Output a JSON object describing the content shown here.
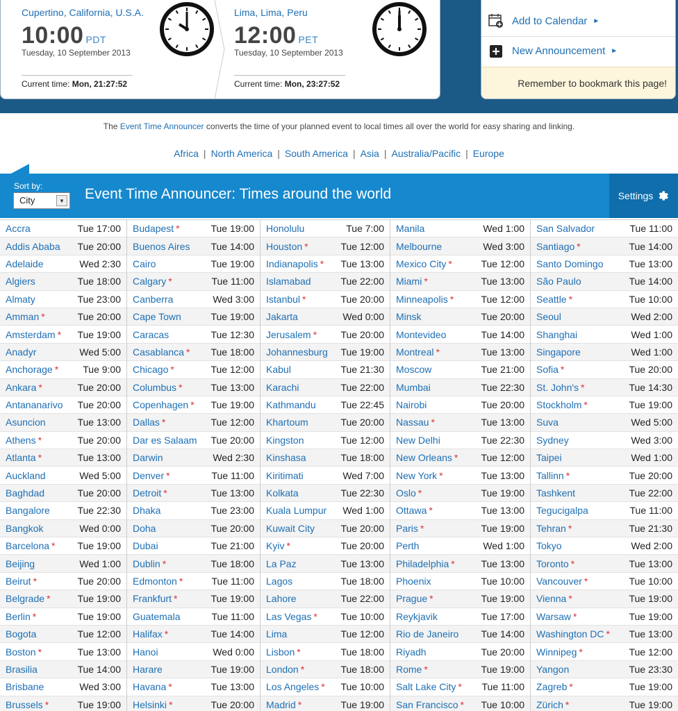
{
  "locations": [
    {
      "name": "Cupertino, California, U.S.A.",
      "time": "10:00",
      "tz": "PDT",
      "date": "Tuesday, 10 September 2013",
      "current_label": "Current time:",
      "current_value": "Mon, 21:27:52"
    },
    {
      "name": "Lima, Lima, Peru",
      "time": "12:00",
      "tz": "PET",
      "date": "Tuesday, 10 September 2013",
      "current_label": "Current time:",
      "current_value": "Mon, 23:27:52"
    }
  ],
  "side": {
    "add_calendar": "Add to Calendar",
    "new_announcement": "New Announcement",
    "bookmark": "Remember to bookmark this page!"
  },
  "intro": {
    "pre": "The ",
    "link": "Event Time Announcer",
    "post": " converts the time of your planned event to local times all over the world for easy sharing and linking."
  },
  "regions": [
    "Africa",
    "North America",
    "South America",
    "Asia",
    "Australia/Pacific",
    "Europe"
  ],
  "banner": {
    "sort_label": "Sort by:",
    "sort_value": "City",
    "title": "Event Time Announcer: Times around the world",
    "settings": "Settings"
  },
  "columns": [
    [
      {
        "city": "Accra",
        "dst": false,
        "time": "Tue 17:00"
      },
      {
        "city": "Addis Ababa",
        "dst": false,
        "time": "Tue 20:00"
      },
      {
        "city": "Adelaide",
        "dst": false,
        "time": "Wed 2:30"
      },
      {
        "city": "Algiers",
        "dst": false,
        "time": "Tue 18:00"
      },
      {
        "city": "Almaty",
        "dst": false,
        "time": "Tue 23:00"
      },
      {
        "city": "Amman",
        "dst": true,
        "time": "Tue 20:00"
      },
      {
        "city": "Amsterdam",
        "dst": true,
        "time": "Tue 19:00"
      },
      {
        "city": "Anadyr",
        "dst": false,
        "time": "Wed 5:00"
      },
      {
        "city": "Anchorage",
        "dst": true,
        "time": "Tue 9:00"
      },
      {
        "city": "Ankara",
        "dst": true,
        "time": "Tue 20:00"
      },
      {
        "city": "Antananarivo",
        "dst": false,
        "time": "Tue 20:00"
      },
      {
        "city": "Asuncion",
        "dst": false,
        "time": "Tue 13:00"
      },
      {
        "city": "Athens",
        "dst": true,
        "time": "Tue 20:00"
      },
      {
        "city": "Atlanta",
        "dst": true,
        "time": "Tue 13:00"
      },
      {
        "city": "Auckland",
        "dst": false,
        "time": "Wed 5:00"
      },
      {
        "city": "Baghdad",
        "dst": false,
        "time": "Tue 20:00"
      },
      {
        "city": "Bangalore",
        "dst": false,
        "time": "Tue 22:30"
      },
      {
        "city": "Bangkok",
        "dst": false,
        "time": "Wed 0:00"
      },
      {
        "city": "Barcelona",
        "dst": true,
        "time": "Tue 19:00"
      },
      {
        "city": "Beijing",
        "dst": false,
        "time": "Wed 1:00"
      },
      {
        "city": "Beirut",
        "dst": true,
        "time": "Tue 20:00"
      },
      {
        "city": "Belgrade",
        "dst": true,
        "time": "Tue 19:00"
      },
      {
        "city": "Berlin",
        "dst": true,
        "time": "Tue 19:00"
      },
      {
        "city": "Bogota",
        "dst": false,
        "time": "Tue 12:00"
      },
      {
        "city": "Boston",
        "dst": true,
        "time": "Tue 13:00"
      },
      {
        "city": "Brasilia",
        "dst": false,
        "time": "Tue 14:00"
      },
      {
        "city": "Brisbane",
        "dst": false,
        "time": "Wed 3:00"
      },
      {
        "city": "Brussels",
        "dst": true,
        "time": "Tue 19:00"
      }
    ],
    [
      {
        "city": "Budapest",
        "dst": true,
        "time": "Tue 19:00"
      },
      {
        "city": "Buenos Aires",
        "dst": false,
        "time": "Tue 14:00"
      },
      {
        "city": "Cairo",
        "dst": false,
        "time": "Tue 19:00"
      },
      {
        "city": "Calgary",
        "dst": true,
        "time": "Tue 11:00"
      },
      {
        "city": "Canberra",
        "dst": false,
        "time": "Wed 3:00"
      },
      {
        "city": "Cape Town",
        "dst": false,
        "time": "Tue 19:00"
      },
      {
        "city": "Caracas",
        "dst": false,
        "time": "Tue 12:30"
      },
      {
        "city": "Casablanca",
        "dst": true,
        "time": "Tue 18:00"
      },
      {
        "city": "Chicago",
        "dst": true,
        "time": "Tue 12:00"
      },
      {
        "city": "Columbus",
        "dst": true,
        "time": "Tue 13:00"
      },
      {
        "city": "Copenhagen",
        "dst": true,
        "time": "Tue 19:00"
      },
      {
        "city": "Dallas",
        "dst": true,
        "time": "Tue 12:00"
      },
      {
        "city": "Dar es Salaam",
        "dst": false,
        "time": "Tue 20:00"
      },
      {
        "city": "Darwin",
        "dst": false,
        "time": "Wed 2:30"
      },
      {
        "city": "Denver",
        "dst": true,
        "time": "Tue 11:00"
      },
      {
        "city": "Detroit",
        "dst": true,
        "time": "Tue 13:00"
      },
      {
        "city": "Dhaka",
        "dst": false,
        "time": "Tue 23:00"
      },
      {
        "city": "Doha",
        "dst": false,
        "time": "Tue 20:00"
      },
      {
        "city": "Dubai",
        "dst": false,
        "time": "Tue 21:00"
      },
      {
        "city": "Dublin",
        "dst": true,
        "time": "Tue 18:00"
      },
      {
        "city": "Edmonton",
        "dst": true,
        "time": "Tue 11:00"
      },
      {
        "city": "Frankfurt",
        "dst": true,
        "time": "Tue 19:00"
      },
      {
        "city": "Guatemala",
        "dst": false,
        "time": "Tue 11:00"
      },
      {
        "city": "Halifax",
        "dst": true,
        "time": "Tue 14:00"
      },
      {
        "city": "Hanoi",
        "dst": false,
        "time": "Wed 0:00"
      },
      {
        "city": "Harare",
        "dst": false,
        "time": "Tue 19:00"
      },
      {
        "city": "Havana",
        "dst": true,
        "time": "Tue 13:00"
      },
      {
        "city": "Helsinki",
        "dst": true,
        "time": "Tue 20:00"
      }
    ],
    [
      {
        "city": "Honolulu",
        "dst": false,
        "time": "Tue 7:00"
      },
      {
        "city": "Houston",
        "dst": true,
        "time": "Tue 12:00"
      },
      {
        "city": "Indianapolis",
        "dst": true,
        "time": "Tue 13:00"
      },
      {
        "city": "Islamabad",
        "dst": false,
        "time": "Tue 22:00"
      },
      {
        "city": "Istanbul",
        "dst": true,
        "time": "Tue 20:00"
      },
      {
        "city": "Jakarta",
        "dst": false,
        "time": "Wed 0:00"
      },
      {
        "city": "Jerusalem",
        "dst": true,
        "time": "Tue 20:00"
      },
      {
        "city": "Johannesburg",
        "dst": false,
        "time": "Tue 19:00"
      },
      {
        "city": "Kabul",
        "dst": false,
        "time": "Tue 21:30"
      },
      {
        "city": "Karachi",
        "dst": false,
        "time": "Tue 22:00"
      },
      {
        "city": "Kathmandu",
        "dst": false,
        "time": "Tue 22:45"
      },
      {
        "city": "Khartoum",
        "dst": false,
        "time": "Tue 20:00"
      },
      {
        "city": "Kingston",
        "dst": false,
        "time": "Tue 12:00"
      },
      {
        "city": "Kinshasa",
        "dst": false,
        "time": "Tue 18:00"
      },
      {
        "city": "Kiritimati",
        "dst": false,
        "time": "Wed 7:00"
      },
      {
        "city": "Kolkata",
        "dst": false,
        "time": "Tue 22:30"
      },
      {
        "city": "Kuala Lumpur",
        "dst": false,
        "time": "Wed 1:00"
      },
      {
        "city": "Kuwait City",
        "dst": false,
        "time": "Tue 20:00"
      },
      {
        "city": "Kyiv",
        "dst": true,
        "time": "Tue 20:00"
      },
      {
        "city": "La Paz",
        "dst": false,
        "time": "Tue 13:00"
      },
      {
        "city": "Lagos",
        "dst": false,
        "time": "Tue 18:00"
      },
      {
        "city": "Lahore",
        "dst": false,
        "time": "Tue 22:00"
      },
      {
        "city": "Las Vegas",
        "dst": true,
        "time": "Tue 10:00"
      },
      {
        "city": "Lima",
        "dst": false,
        "time": "Tue 12:00"
      },
      {
        "city": "Lisbon",
        "dst": true,
        "time": "Tue 18:00"
      },
      {
        "city": "London",
        "dst": true,
        "time": "Tue 18:00"
      },
      {
        "city": "Los Angeles",
        "dst": true,
        "time": "Tue 10:00"
      },
      {
        "city": "Madrid",
        "dst": true,
        "time": "Tue 19:00"
      }
    ],
    [
      {
        "city": "Manila",
        "dst": false,
        "time": "Wed 1:00"
      },
      {
        "city": "Melbourne",
        "dst": false,
        "time": "Wed 3:00"
      },
      {
        "city": "Mexico City",
        "dst": true,
        "time": "Tue 12:00"
      },
      {
        "city": "Miami",
        "dst": true,
        "time": "Tue 13:00"
      },
      {
        "city": "Minneapolis",
        "dst": true,
        "time": "Tue 12:00"
      },
      {
        "city": "Minsk",
        "dst": false,
        "time": "Tue 20:00"
      },
      {
        "city": "Montevideo",
        "dst": false,
        "time": "Tue 14:00"
      },
      {
        "city": "Montreal",
        "dst": true,
        "time": "Tue 13:00"
      },
      {
        "city": "Moscow",
        "dst": false,
        "time": "Tue 21:00"
      },
      {
        "city": "Mumbai",
        "dst": false,
        "time": "Tue 22:30"
      },
      {
        "city": "Nairobi",
        "dst": false,
        "time": "Tue 20:00"
      },
      {
        "city": "Nassau",
        "dst": true,
        "time": "Tue 13:00"
      },
      {
        "city": "New Delhi",
        "dst": false,
        "time": "Tue 22:30"
      },
      {
        "city": "New Orleans",
        "dst": true,
        "time": "Tue 12:00"
      },
      {
        "city": "New York",
        "dst": true,
        "time": "Tue 13:00"
      },
      {
        "city": "Oslo",
        "dst": true,
        "time": "Tue 19:00"
      },
      {
        "city": "Ottawa",
        "dst": true,
        "time": "Tue 13:00"
      },
      {
        "city": "Paris",
        "dst": true,
        "time": "Tue 19:00"
      },
      {
        "city": "Perth",
        "dst": false,
        "time": "Wed 1:00"
      },
      {
        "city": "Philadelphia",
        "dst": true,
        "time": "Tue 13:00"
      },
      {
        "city": "Phoenix",
        "dst": false,
        "time": "Tue 10:00"
      },
      {
        "city": "Prague",
        "dst": true,
        "time": "Tue 19:00"
      },
      {
        "city": "Reykjavik",
        "dst": false,
        "time": "Tue 17:00"
      },
      {
        "city": "Rio de Janeiro",
        "dst": false,
        "time": "Tue 14:00"
      },
      {
        "city": "Riyadh",
        "dst": false,
        "time": "Tue 20:00"
      },
      {
        "city": "Rome",
        "dst": true,
        "time": "Tue 19:00"
      },
      {
        "city": "Salt Lake City",
        "dst": true,
        "time": "Tue 11:00"
      },
      {
        "city": "San Francisco",
        "dst": true,
        "time": "Tue 10:00"
      }
    ],
    [
      {
        "city": "San Salvador",
        "dst": false,
        "time": "Tue 11:00"
      },
      {
        "city": "Santiago",
        "dst": true,
        "time": "Tue 14:00"
      },
      {
        "city": "Santo Domingo",
        "dst": false,
        "time": "Tue 13:00"
      },
      {
        "city": "São Paulo",
        "dst": false,
        "time": "Tue 14:00"
      },
      {
        "city": "Seattle",
        "dst": true,
        "time": "Tue 10:00"
      },
      {
        "city": "Seoul",
        "dst": false,
        "time": "Wed 2:00"
      },
      {
        "city": "Shanghai",
        "dst": false,
        "time": "Wed 1:00"
      },
      {
        "city": "Singapore",
        "dst": false,
        "time": "Wed 1:00"
      },
      {
        "city": "Sofia",
        "dst": true,
        "time": "Tue 20:00"
      },
      {
        "city": "St. John's",
        "dst": true,
        "time": "Tue 14:30"
      },
      {
        "city": "Stockholm",
        "dst": true,
        "time": "Tue 19:00"
      },
      {
        "city": "Suva",
        "dst": false,
        "time": "Wed 5:00"
      },
      {
        "city": "Sydney",
        "dst": false,
        "time": "Wed 3:00"
      },
      {
        "city": "Taipei",
        "dst": false,
        "time": "Wed 1:00"
      },
      {
        "city": "Tallinn",
        "dst": true,
        "time": "Tue 20:00"
      },
      {
        "city": "Tashkent",
        "dst": false,
        "time": "Tue 22:00"
      },
      {
        "city": "Tegucigalpa",
        "dst": false,
        "time": "Tue 11:00"
      },
      {
        "city": "Tehran",
        "dst": true,
        "time": "Tue 21:30"
      },
      {
        "city": "Tokyo",
        "dst": false,
        "time": "Wed 2:00"
      },
      {
        "city": "Toronto",
        "dst": true,
        "time": "Tue 13:00"
      },
      {
        "city": "Vancouver",
        "dst": true,
        "time": "Tue 10:00"
      },
      {
        "city": "Vienna",
        "dst": true,
        "time": "Tue 19:00"
      },
      {
        "city": "Warsaw",
        "dst": true,
        "time": "Tue 19:00"
      },
      {
        "city": "Washington DC",
        "dst": true,
        "time": "Tue 13:00"
      },
      {
        "city": "Winnipeg",
        "dst": true,
        "time": "Tue 12:00"
      },
      {
        "city": "Yangon",
        "dst": false,
        "time": "Tue 23:30"
      },
      {
        "city": "Zagreb",
        "dst": true,
        "time": "Tue 19:00"
      },
      {
        "city": "Zürich",
        "dst": true,
        "time": "Tue 19:00"
      }
    ]
  ],
  "dst_mark": "*",
  "icons": {
    "calendar": "calendar-add-icon",
    "plus": "plus-square-icon",
    "gear": "gear-icon",
    "clock": "analog-clock-icon"
  },
  "colors": {
    "header": "#1b5a86",
    "banner": "#1688cd",
    "link": "#1e6fb4",
    "dst": "#d9333a",
    "bookmark_bg": "#fdf6dc"
  }
}
